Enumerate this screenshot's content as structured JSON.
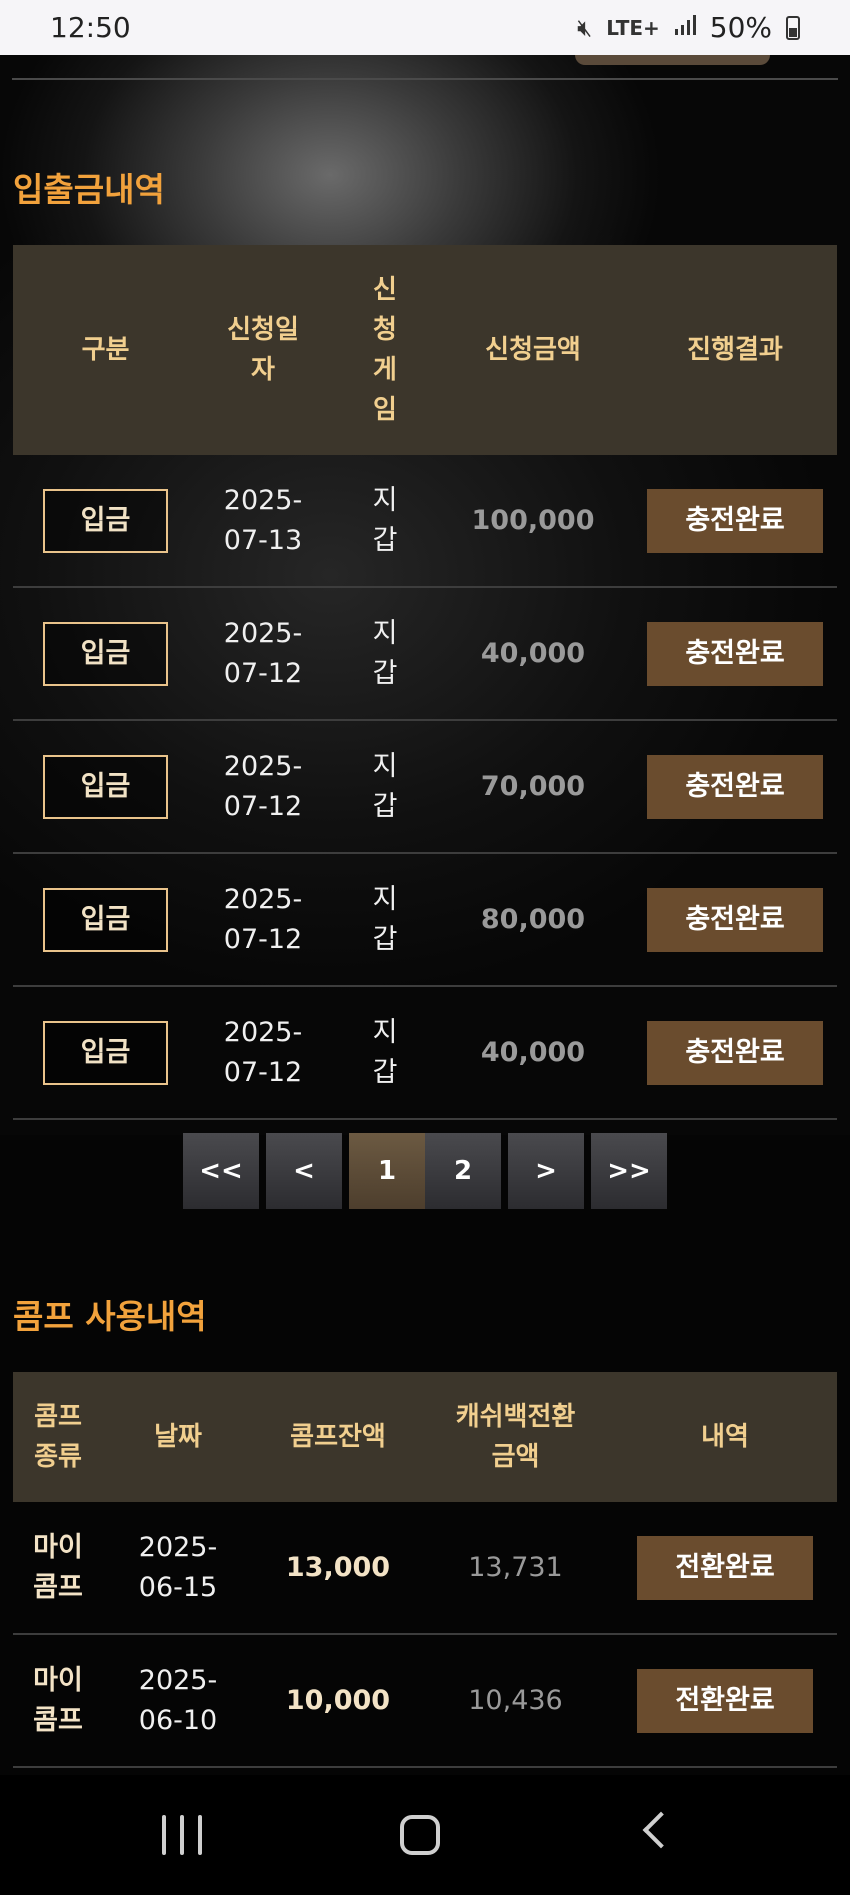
{
  "status_bar": {
    "time": "12:50",
    "network": "LTE+",
    "battery": "50%",
    "icons": [
      "mute-icon",
      "signal-icon",
      "battery-icon"
    ]
  },
  "deposits": {
    "title": "입출금내역",
    "headers": {
      "type": "구분",
      "date": "신청일자",
      "game": "신청게임",
      "amount": "신청금액",
      "result": "진행결과"
    },
    "rows": [
      {
        "type": "입금",
        "date": "2025-07-13",
        "game": "지갑",
        "amount": "100,000",
        "result": "충전완료"
      },
      {
        "type": "입금",
        "date": "2025-07-12",
        "game": "지갑",
        "amount": "40,000",
        "result": "충전완료"
      },
      {
        "type": "입금",
        "date": "2025-07-12",
        "game": "지갑",
        "amount": "70,000",
        "result": "충전완료"
      },
      {
        "type": "입금",
        "date": "2025-07-12",
        "game": "지갑",
        "amount": "80,000",
        "result": "충전완료"
      },
      {
        "type": "입금",
        "date": "2025-07-12",
        "game": "지갑",
        "amount": "40,000",
        "result": "충전완료"
      }
    ]
  },
  "pagination": {
    "first": "<<",
    "prev": "<",
    "pages": [
      "1",
      "2"
    ],
    "current_page": "1",
    "next": ">",
    "last": ">>"
  },
  "comp": {
    "title": "콤프 사용내역",
    "headers": {
      "kind": "콤프종류",
      "date": "날짜",
      "balance": "콤프잔액",
      "cashback": "캐쉬백전환금액",
      "detail": "내역"
    },
    "rows": [
      {
        "kind": "마이콤프",
        "date": "2025-06-15",
        "balance": "13,000",
        "cashback": "13,731",
        "detail": "전환완료"
      },
      {
        "kind": "마이콤프",
        "date": "2025-06-10",
        "balance": "10,000",
        "cashback": "10,436",
        "detail": "전환완료"
      }
    ]
  },
  "nav_bar": {
    "icons": [
      "recent-apps-icon",
      "home-icon",
      "back-icon"
    ]
  }
}
